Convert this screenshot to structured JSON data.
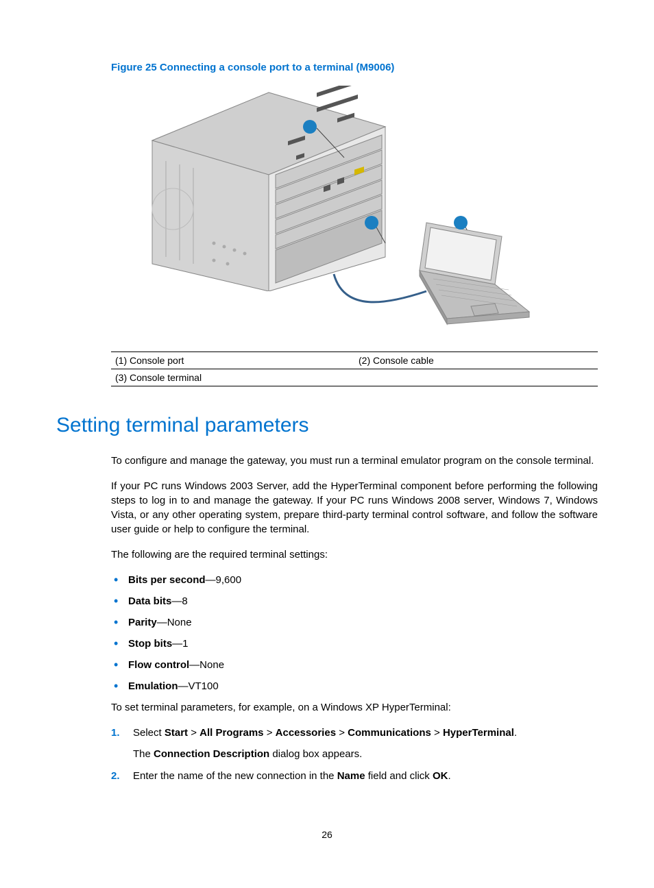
{
  "figure": {
    "caption": "Figure 25 Connecting a console port to a terminal (M9006)",
    "legend": {
      "row1": {
        "c1": "(1) Console port",
        "c2": "(2) Console cable"
      },
      "row2": {
        "c1": "(3) Console terminal",
        "c2": ""
      }
    }
  },
  "heading": "Setting terminal parameters",
  "para1": "To configure and manage the gateway, you must run a terminal emulator program on the console terminal.",
  "para2": "If your PC runs Windows 2003 Server, add the HyperTerminal component before performing the following steps to log in to and manage the gateway. If your PC runs Windows 2008 server, Windows 7, Windows Vista, or any other operating system, prepare third-party terminal control software, and follow the software user guide or help to configure the terminal.",
  "para3": "The following are the required terminal settings:",
  "bullets": [
    {
      "label": "Bits per second",
      "value": "—9,600"
    },
    {
      "label": "Data bits",
      "value": "—8"
    },
    {
      "label": "Parity",
      "value": "—None"
    },
    {
      "label": "Stop bits",
      "value": "—1"
    },
    {
      "label": "Flow control",
      "value": "—None"
    },
    {
      "label": "Emulation",
      "value": "—VT100"
    }
  ],
  "para4": "To set terminal parameters, for example, on a Windows XP HyperTerminal:",
  "steps": {
    "s1": {
      "prefix": "Select ",
      "b1": "Start",
      "gt1": " > ",
      "b2": "All Programs",
      "gt2": " > ",
      "b3": "Accessories",
      "gt3": " > ",
      "b4": "Communications",
      "gt4": " > ",
      "b5": "HyperTerminal",
      "suffix": ".",
      "sub_prefix": "The ",
      "sub_bold": "Connection Description",
      "sub_suffix": " dialog box appears."
    },
    "s2": {
      "t1": "Enter the name of the new connection in the ",
      "b1": "Name",
      "t2": " field and click ",
      "b2": "OK",
      "t3": "."
    }
  },
  "page_number": "26"
}
